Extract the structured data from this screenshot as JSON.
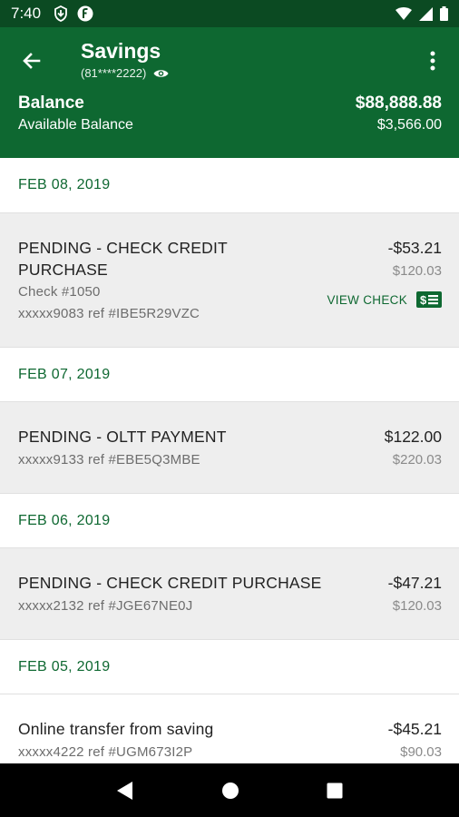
{
  "status_bar": {
    "time": "7:40",
    "icons_left": [
      "shield-download-icon",
      "f-circle-icon"
    ],
    "icons_right": [
      "wifi-icon",
      "signal-icon",
      "battery-icon"
    ]
  },
  "header": {
    "title": "Savings",
    "account_mask": "(81****2222)",
    "balance_label": "Balance",
    "balance_value": "$88,888.88",
    "available_label": "Available Balance",
    "available_value": "$3,566.00",
    "accent_color": "#0e6831"
  },
  "sections": [
    {
      "date": "FEB 08, 2019",
      "transactions": [
        {
          "description_line1": "PENDING - CHECK CREDIT",
          "description_line2": "PURCHASE",
          "check_number": "Check #1050",
          "reference": "xxxxx9083 ref #IBE5R29VZC",
          "amount": "-$53.21",
          "running_balance": "$120.03",
          "action_label": "VIEW CHECK"
        }
      ]
    },
    {
      "date": "FEB 07, 2019",
      "transactions": [
        {
          "description": "PENDING - OLTT PAYMENT",
          "reference": "xxxxx9133 ref #EBE5Q3MBE",
          "amount": "$122.00",
          "running_balance": "$220.03"
        }
      ]
    },
    {
      "date": "FEB 06, 2019",
      "transactions": [
        {
          "description": "PENDING - CHECK CREDIT PURCHASE",
          "reference": "xxxxx2132 ref #JGE67NE0J",
          "amount": "-$47.21",
          "running_balance": "$120.03"
        }
      ]
    },
    {
      "date": "FEB 05, 2019",
      "transactions": [
        {
          "description": "Online transfer from saving",
          "reference": "xxxxx4222 ref #UGM673I2P",
          "amount": "-$45.21",
          "running_balance": "$90.03"
        }
      ]
    }
  ],
  "nav_bar": {
    "buttons": [
      "back-triangle-icon",
      "home-circle-icon",
      "recents-square-icon"
    ]
  }
}
